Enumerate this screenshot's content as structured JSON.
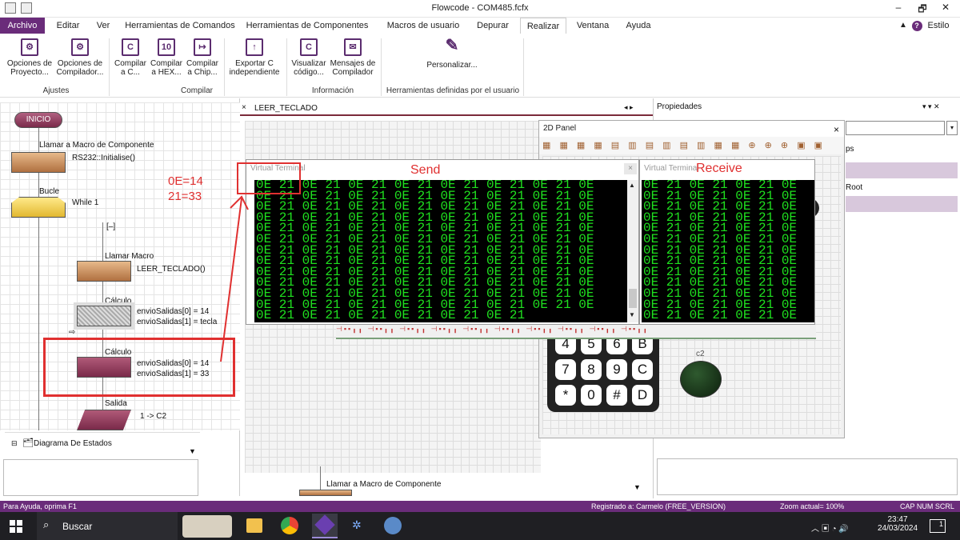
{
  "window": {
    "title": "Flowcode - COM485.fcfx",
    "minimize": "–",
    "restore": "🗗",
    "close": "✕"
  },
  "menu": {
    "items": [
      "Archivo",
      "Editar",
      "Ver",
      "Herramientas de Comandos",
      "Herramientas de Componentes",
      "Macros de usuario",
      "Depurar",
      "Realizar",
      "Ventana",
      "Ayuda"
    ],
    "active": "Realizar",
    "style": "Estilo"
  },
  "ribbon": {
    "buttons": [
      {
        "l1": "Opciones de",
        "l2": "Proyecto...",
        "icon": "⚙"
      },
      {
        "l1": "Opciones de",
        "l2": "Compilador...",
        "icon": "⚙"
      },
      {
        "l1": "Compilar",
        "l2": "a C...",
        "icon": "C"
      },
      {
        "l1": "Compilar",
        "l2": "a HEX...",
        "icon": "10"
      },
      {
        "l1": "Compilar",
        "l2": "a Chip...",
        "icon": "↦"
      },
      {
        "l1": "Exportar C",
        "l2": "independiente",
        "icon": "↑"
      },
      {
        "l1": "Visualizar",
        "l2": "código...",
        "icon": "C"
      },
      {
        "l1": "Mensajes de",
        "l2": "Compilador",
        "icon": "✉"
      },
      {
        "l1": "Personalizar...",
        "l2": "",
        "icon": "✎"
      }
    ],
    "groups": [
      "Ajustes",
      "Compilar",
      "Información",
      "Herramientas definidas por el usuario"
    ]
  },
  "flow": {
    "start": "INICIO",
    "macro1_title": "Llamar a Macro de Componente",
    "macro1_text": "RS232::Initialise()",
    "loop_title": "Bucle",
    "loop_text": "While 1",
    "collapse": "[–]",
    "macro2_title": "Llamar Macro",
    "macro2_text": "LEER_TECLADO()",
    "calc1_title": "Cálculo",
    "calc1_line1": "envioSalidas[0] = 14",
    "calc1_line2": "envioSalidas[1] = tecla",
    "calc2_title": "Cálculo",
    "calc2_line1": "envioSalidas[0] = 14",
    "calc2_line2": "envioSalidas[1] = 33",
    "out_title": "Salida",
    "out_text": "1 -> C2",
    "tree_item": "Diagrama De Estados",
    "bottom_macro": "Llamar a Macro de Componente"
  },
  "annotation": {
    "line1": "0E=14",
    "line2": "21=33",
    "send": "Send",
    "receive": "Receive"
  },
  "middle": {
    "tab": "LEER_TECLADO",
    "tab_close": "×"
  },
  "panel2d": {
    "title": "2D Panel",
    "close": "×",
    "c2_label": "c2"
  },
  "terminal_send": {
    "title": "Virtual Terminal",
    "close": "×",
    "row": "0E 21 0E 21 0E 21 0E 21 0E 21 0E 21 0E 21 0E",
    "last": "0E 21 0E 21 0E 21 0E 21 0E 21 0E 21",
    "rows": 12
  },
  "terminal_recv": {
    "title": "Virtual Terminal",
    "row": "0E 21 0E 21 0E 21 0E",
    "rows": 13
  },
  "keypad": {
    "rows": [
      [
        "4",
        "5",
        "6",
        "B"
      ],
      [
        "7",
        "8",
        "9",
        "C"
      ],
      [
        "*",
        "0",
        "#",
        "D"
      ]
    ]
  },
  "properties": {
    "title": "Propiedades",
    "frag_ps": "ps",
    "root": "Root"
  },
  "status": {
    "help": "Para Ayuda, oprima F1",
    "registered": "Registrado a: Carmelo (FREE_VERSION)",
    "zoom": "Zoom actual= 100%",
    "caps": "CAP  NUM  SCRL"
  },
  "taskbar": {
    "search": "Buscar",
    "time": "23:47",
    "date": "24/03/2024",
    "notif": "1"
  },
  "colors": {
    "accent": "#6a2c7a",
    "terminal_text": "#1fe01f",
    "annotation": "#e03030"
  }
}
